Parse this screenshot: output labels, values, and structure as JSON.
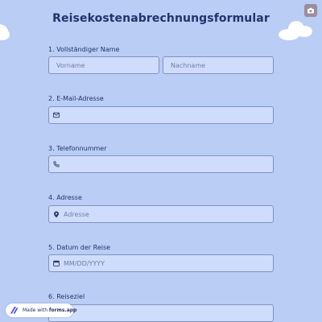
{
  "header": {
    "title": "Reisekostenabrechnungsformular",
    "corner_icon": "camera-icon"
  },
  "questions": [
    {
      "number": "1.",
      "label": "Vollständiger Name",
      "fields": [
        {
          "placeholder": "Vorname"
        },
        {
          "placeholder": "Nachname"
        }
      ]
    },
    {
      "number": "2.",
      "label": "E-Mail-Adresse",
      "icon": "envelope-icon",
      "value": ""
    },
    {
      "number": "3.",
      "label": "Telefonnummer",
      "icon": "phone-icon",
      "value": ""
    },
    {
      "number": "4.",
      "label": "Adresse",
      "icon": "location-pin-icon",
      "placeholder": "Adresse"
    },
    {
      "number": "5.",
      "label": "Datum der Reise",
      "icon": "calendar-icon",
      "placeholder": "MM/DD/YYYY"
    },
    {
      "number": "6.",
      "label": "Reiseziel"
    }
  ],
  "footer": {
    "badge_prefix": "Made with ",
    "badge_brand": "forms.app",
    "badge_icon": "forms-app-logo-icon"
  },
  "colors": {
    "background": "#b9cdf5",
    "field_background": "#cfdcfb",
    "field_border": "#7f92c4",
    "title_text": "#22336b"
  }
}
